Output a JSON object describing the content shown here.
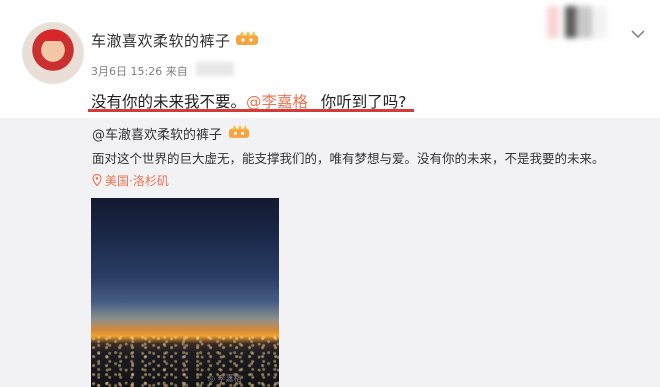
{
  "post": {
    "username": "车澈喜欢柔软的裤子",
    "date": "3月6日 15:26 来自",
    "text_before": "没有你的未来我不要。",
    "mention": "@李嘉格_",
    "text_after": " 你听到了吗?"
  },
  "repost": {
    "user": "@车澈喜欢柔软的裤子",
    "text": "面对这个世界的巨大虚无，能支撑我们的，唯有梦想与爱。没有你的未来，不是我要的未来。",
    "location": "美国·洛杉矶"
  },
  "colors": {
    "mention": "#eb7350",
    "underline": "#d83a3a",
    "repost_bg": "#f2f2f5"
  },
  "icons": [
    "avatar",
    "vip-badge-icon",
    "chevron-down-icon",
    "location-pin-icon"
  ]
}
